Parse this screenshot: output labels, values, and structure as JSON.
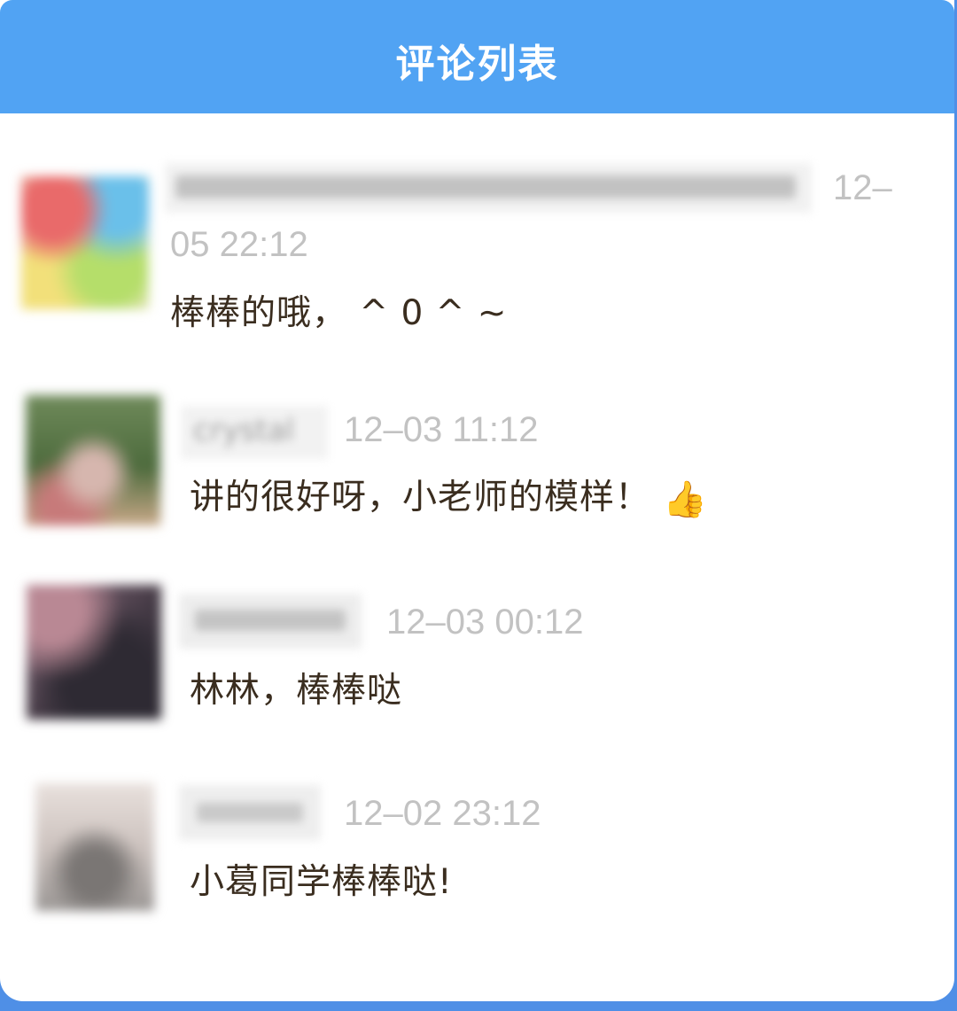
{
  "header": {
    "title": "评论列表"
  },
  "comments": [
    {
      "time_line1": "12–",
      "time_line2": "05 22:12",
      "content": "棒棒的哦， ^ 0 ^ ~"
    },
    {
      "name": "crystal",
      "time": "12–03 11:12",
      "content": "讲的很好呀，小老师的模样！",
      "emoji_icon": "thumbs-up-icon",
      "emoji": "👍"
    },
    {
      "time": "12–03 00:12",
      "content": "林林，棒棒哒"
    },
    {
      "time": "12–02 23:12",
      "content": "小葛同学棒棒哒!"
    }
  ]
}
